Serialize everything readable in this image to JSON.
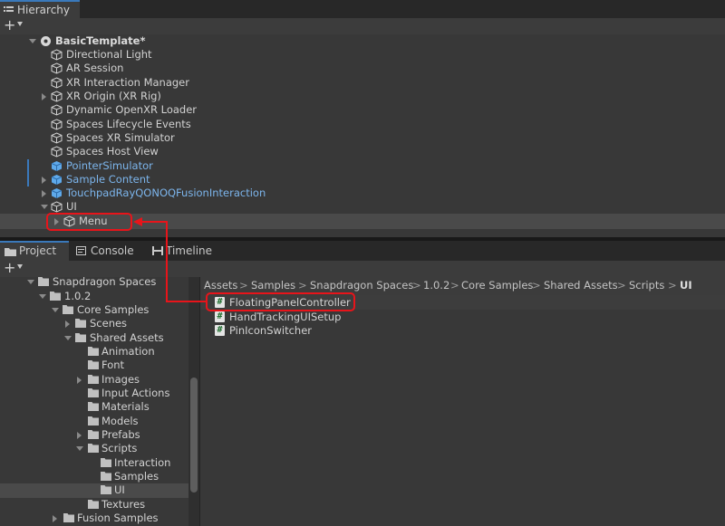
{
  "hierarchy": {
    "tab_label": "Hierarchy",
    "scene_name": "BasicTemplate*",
    "items": [
      {
        "label": "Directional Light"
      },
      {
        "label": "AR Session"
      },
      {
        "label": "XR Interaction Manager"
      },
      {
        "label": "XR Origin (XR Rig)"
      },
      {
        "label": "Dynamic OpenXR Loader"
      },
      {
        "label": "Spaces Lifecycle Events"
      },
      {
        "label": "Spaces XR Simulator"
      },
      {
        "label": "Spaces Host View"
      },
      {
        "label": "PointerSimulator"
      },
      {
        "label": "Sample Content"
      },
      {
        "label": "TouchpadRayQONOQFusionInteraction"
      },
      {
        "label": "UI"
      },
      {
        "label": "Menu"
      }
    ]
  },
  "project": {
    "tabs": [
      {
        "label": "Project"
      },
      {
        "label": "Console"
      },
      {
        "label": "Timeline"
      }
    ],
    "tree": [
      {
        "label": "Snapdragon Spaces"
      },
      {
        "label": "1.0.2"
      },
      {
        "label": "Core Samples"
      },
      {
        "label": "Scenes"
      },
      {
        "label": "Shared Assets"
      },
      {
        "label": "Animation"
      },
      {
        "label": "Font"
      },
      {
        "label": "Images"
      },
      {
        "label": "Input Actions"
      },
      {
        "label": "Materials"
      },
      {
        "label": "Models"
      },
      {
        "label": "Prefabs"
      },
      {
        "label": "Scripts"
      },
      {
        "label": "Interaction"
      },
      {
        "label": "Samples"
      },
      {
        "label": "UI"
      },
      {
        "label": "Textures"
      },
      {
        "label": "Fusion Samples"
      }
    ],
    "breadcrumb": [
      "Assets",
      "Samples",
      "Snapdragon Spaces",
      "1.0.2",
      "Core Samples",
      "Shared Assets",
      "Scripts",
      "UI"
    ],
    "files": [
      {
        "label": "FloatingPanelController"
      },
      {
        "label": "HandTrackingUISetup"
      },
      {
        "label": "PinIconSwitcher"
      }
    ]
  },
  "glyphs": {
    "plus": "+",
    "crumb_sep": ">",
    "script_icon": "#"
  },
  "colors": {
    "highlight": "#e8141a",
    "prefab_blue": "#7cb5ec",
    "accent": "#3a79bb"
  }
}
